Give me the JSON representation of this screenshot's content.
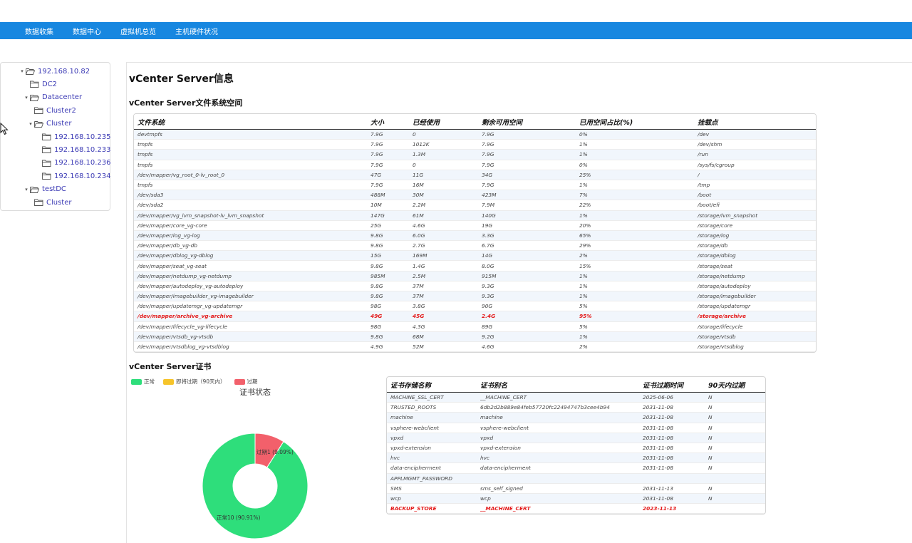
{
  "nav": [
    "数据收集",
    "数据中心",
    "虚拟机总览",
    "主机硬件状况"
  ],
  "tree": [
    {
      "label": "192.168.10.82",
      "level": 0,
      "expanded": true,
      "type": "host"
    },
    {
      "label": "DC2",
      "level": 1,
      "expanded": false,
      "type": "dc"
    },
    {
      "label": "Datacenter",
      "level": 1,
      "expanded": true,
      "type": "dc"
    },
    {
      "label": "Cluster2",
      "level": 2,
      "expanded": false,
      "type": "cluster"
    },
    {
      "label": "Cluster",
      "level": 2,
      "expanded": true,
      "type": "cluster"
    },
    {
      "label": "192.168.10.235",
      "level": 3,
      "expanded": false,
      "type": "host"
    },
    {
      "label": "192.168.10.233",
      "level": 3,
      "expanded": false,
      "type": "host"
    },
    {
      "label": "192.168.10.236",
      "level": 3,
      "expanded": false,
      "type": "host"
    },
    {
      "label": "192.168.10.234",
      "level": 3,
      "expanded": false,
      "type": "host"
    },
    {
      "label": "testDC",
      "level": 1,
      "expanded": true,
      "type": "dc"
    },
    {
      "label": "Cluster",
      "level": 2,
      "expanded": false,
      "type": "cluster"
    }
  ],
  "page_title": "vCenter Server信息",
  "fs_section_title": "vCenter Server文件系统空间",
  "fs_headers": [
    "文件系统",
    "大小",
    "已经使用",
    "剩余可用空间",
    "已用空间占比(%)",
    "挂载点"
  ],
  "fs_rows": [
    {
      "cells": [
        "devtmpfs",
        "7.9G",
        "0",
        "7.9G",
        "0%",
        "/dev"
      ],
      "alert": false
    },
    {
      "cells": [
        "tmpfs",
        "7.9G",
        "1012K",
        "7.9G",
        "1%",
        "/dev/shm"
      ],
      "alert": false
    },
    {
      "cells": [
        "tmpfs",
        "7.9G",
        "1.3M",
        "7.9G",
        "1%",
        "/run"
      ],
      "alert": false
    },
    {
      "cells": [
        "tmpfs",
        "7.9G",
        "0",
        "7.9G",
        "0%",
        "/sys/fs/cgroup"
      ],
      "alert": false
    },
    {
      "cells": [
        "/dev/mapper/vg_root_0-lv_root_0",
        "47G",
        "11G",
        "34G",
        "25%",
        "/"
      ],
      "alert": false
    },
    {
      "cells": [
        "tmpfs",
        "7.9G",
        "16M",
        "7.9G",
        "1%",
        "/tmp"
      ],
      "alert": false
    },
    {
      "cells": [
        "/dev/sda3",
        "488M",
        "30M",
        "423M",
        "7%",
        "/boot"
      ],
      "alert": false
    },
    {
      "cells": [
        "/dev/sda2",
        "10M",
        "2.2M",
        "7.9M",
        "22%",
        "/boot/efi"
      ],
      "alert": false
    },
    {
      "cells": [
        "/dev/mapper/vg_lvm_snapshot-lv_lvm_snapshot",
        "147G",
        "61M",
        "140G",
        "1%",
        "/storage/lvm_snapshot"
      ],
      "alert": false
    },
    {
      "cells": [
        "/dev/mapper/core_vg-core",
        "25G",
        "4.6G",
        "19G",
        "20%",
        "/storage/core"
      ],
      "alert": false
    },
    {
      "cells": [
        "/dev/mapper/log_vg-log",
        "9.8G",
        "6.0G",
        "3.3G",
        "65%",
        "/storage/log"
      ],
      "alert": false
    },
    {
      "cells": [
        "/dev/mapper/db_vg-db",
        "9.8G",
        "2.7G",
        "6.7G",
        "29%",
        "/storage/db"
      ],
      "alert": false
    },
    {
      "cells": [
        "/dev/mapper/dblog_vg-dblog",
        "15G",
        "169M",
        "14G",
        "2%",
        "/storage/dblog"
      ],
      "alert": false
    },
    {
      "cells": [
        "/dev/mapper/seat_vg-seat",
        "9.8G",
        "1.4G",
        "8.0G",
        "15%",
        "/storage/seat"
      ],
      "alert": false
    },
    {
      "cells": [
        "/dev/mapper/netdump_vg-netdump",
        "985M",
        "2.5M",
        "915M",
        "1%",
        "/storage/netdump"
      ],
      "alert": false
    },
    {
      "cells": [
        "/dev/mapper/autodeploy_vg-autodeploy",
        "9.8G",
        "37M",
        "9.3G",
        "1%",
        "/storage/autodeploy"
      ],
      "alert": false
    },
    {
      "cells": [
        "/dev/mapper/imagebuilder_vg-imagebuilder",
        "9.8G",
        "37M",
        "9.3G",
        "1%",
        "/storage/imagebuilder"
      ],
      "alert": false
    },
    {
      "cells": [
        "/dev/mapper/updatemgr_vg-updatemgr",
        "98G",
        "3.8G",
        "90G",
        "5%",
        "/storage/updatemgr"
      ],
      "alert": false
    },
    {
      "cells": [
        "/dev/mapper/archive_vg-archive",
        "49G",
        "45G",
        "2.4G",
        "95%",
        "/storage/archive"
      ],
      "alert": true
    },
    {
      "cells": [
        "/dev/mapper/lifecycle_vg-lifecycle",
        "98G",
        "4.3G",
        "89G",
        "5%",
        "/storage/lifecycle"
      ],
      "alert": false
    },
    {
      "cells": [
        "/dev/mapper/vtsdb_vg-vtsdb",
        "9.8G",
        "68M",
        "9.2G",
        "1%",
        "/storage/vtsdb"
      ],
      "alert": false
    },
    {
      "cells": [
        "/dev/mapper/vtsdblog_vg-vtsdblog",
        "4.9G",
        "52M",
        "4.6G",
        "2%",
        "/storage/vtsdblog"
      ],
      "alert": false
    }
  ],
  "cert_section_title": "vCenter Server证书",
  "legend": [
    {
      "label": "正常",
      "color": "#2ede7b"
    },
    {
      "label": "即将过期（90天内）",
      "color": "#f6c42a"
    },
    {
      "label": "过期",
      "color": "#f2606b"
    }
  ],
  "chart_title": "证书状态",
  "chart_data": {
    "type": "pie",
    "title": "证书状态",
    "categories": [
      "正常",
      "即将过期（90天内）",
      "过期"
    ],
    "values": [
      10,
      0,
      1
    ],
    "data_labels": [
      "正常10 (90.91%)",
      "",
      "过期1 (9.09%)"
    ],
    "colors": [
      "#2ede7b",
      "#f6c42a",
      "#f2606b"
    ],
    "legend": "top-left"
  },
  "cert_headers": [
    "证书存储名称",
    "证书别名",
    "证书过期时间",
    "90天内过期"
  ],
  "cert_rows": [
    {
      "cells": [
        "MACHINE_SSL_CERT",
        "__MACHINE_CERT",
        "2025-06-06",
        "N"
      ],
      "alert": false
    },
    {
      "cells": [
        "TRUSTED_ROOTS",
        "6db2d2b889e84feb57720fc22494747b3cee4b94",
        "2031-11-08",
        "N"
      ],
      "alert": false
    },
    {
      "cells": [
        "machine",
        "machine",
        "2031-11-08",
        "N"
      ],
      "alert": false
    },
    {
      "cells": [
        "vsphere-webclient",
        "vsphere-webclient",
        "2031-11-08",
        "N"
      ],
      "alert": false
    },
    {
      "cells": [
        "vpxd",
        "vpxd",
        "2031-11-08",
        "N"
      ],
      "alert": false
    },
    {
      "cells": [
        "vpxd-extension",
        "vpxd-extension",
        "2031-11-08",
        "N"
      ],
      "alert": false
    },
    {
      "cells": [
        "hvc",
        "hvc",
        "2031-11-08",
        "N"
      ],
      "alert": false
    },
    {
      "cells": [
        "data-encipherment",
        "data-encipherment",
        "2031-11-08",
        "N"
      ],
      "alert": false
    },
    {
      "cells": [
        "APPLMGMT_PASSWORD",
        "",
        "",
        ""
      ],
      "alert": false
    },
    {
      "cells": [
        "SMS",
        "sms_self_signed",
        "2031-11-13",
        "N"
      ],
      "alert": false
    },
    {
      "cells": [
        "wcp",
        "wcp",
        "2031-11-08",
        "N"
      ],
      "alert": false
    },
    {
      "cells": [
        "BACKUP_STORE",
        "__MACHINE_CERT",
        "2023-11-13",
        ""
      ],
      "alert": true
    }
  ]
}
